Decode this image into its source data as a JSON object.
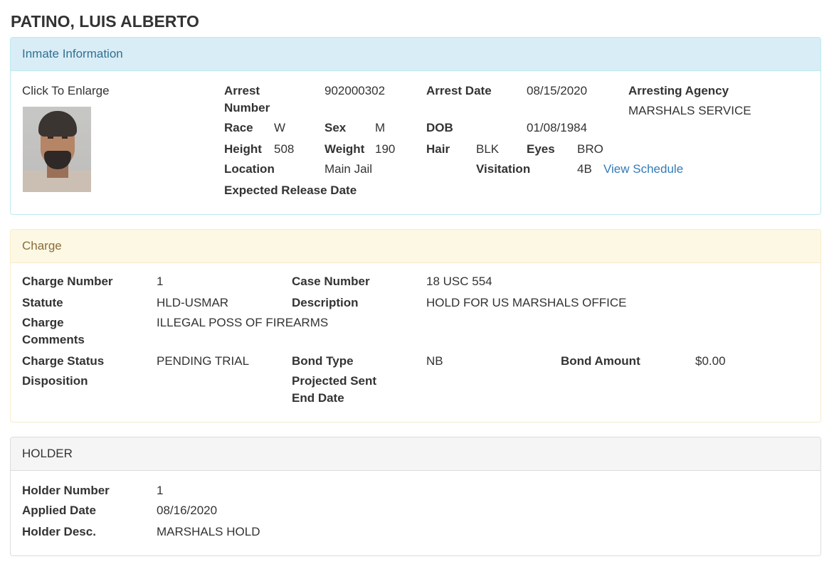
{
  "inmate_name": "PATINO, LUIS ALBERTO",
  "inmate_panel": {
    "heading": "Inmate Information",
    "photo_caption": "Click To Enlarge",
    "arrest_number_label_1": "Arrest",
    "arrest_number_label_2": "Number",
    "arrest_number": "902000302",
    "arrest_date_label": "Arrest Date",
    "arrest_date": "08/15/2020",
    "arresting_agency_label": "Arresting Agency",
    "arresting_agency": "MARSHALS SERVICE",
    "race_label": "Race",
    "race": "W",
    "sex_label": "Sex",
    "sex": "M",
    "dob_label": "DOB",
    "dob": "01/08/1984",
    "height_label": "Height",
    "height": "508",
    "weight_label": "Weight",
    "weight": "190",
    "hair_label": "Hair",
    "hair": "BLK",
    "eyes_label": "Eyes",
    "eyes": "BRO",
    "location_label": "Location",
    "location": "Main Jail",
    "visitation_label": "Visitation",
    "visitation": "4B",
    "view_schedule_link": "View Schedule",
    "expected_release_label": "Expected Release Date"
  },
  "charge_panel": {
    "heading": "Charge",
    "charge_number_label": "Charge Number",
    "charge_number": "1",
    "case_number_label": "Case Number",
    "case_number": "18 USC 554",
    "statute_label": "Statute",
    "statute": "HLD-USMAR",
    "description_label": "Description",
    "description": "HOLD FOR US MARSHALS OFFICE",
    "charge_comments_label_1": "Charge",
    "charge_comments_label_2": "Comments",
    "charge_comments": "ILLEGAL POSS OF FIREARMS",
    "charge_status_label": "Charge Status",
    "charge_status": "PENDING TRIAL",
    "bond_type_label": "Bond Type",
    "bond_type": "NB",
    "bond_amount_label": "Bond Amount",
    "bond_amount": "$0.00",
    "disposition_label": "Disposition",
    "projected_sent_label_1": "Projected Sent",
    "projected_sent_label_2": "End Date"
  },
  "holder_panel": {
    "heading": "HOLDER",
    "holder_number_label": "Holder Number",
    "holder_number": "1",
    "applied_date_label": "Applied Date",
    "applied_date": "08/16/2020",
    "holder_desc_label": "Holder Desc.",
    "holder_desc": "MARSHALS HOLD"
  },
  "colors": {
    "info_heading_bg": "#d9edf7",
    "info_heading_text": "#31708f",
    "warning_heading_bg": "#fcf8e3",
    "warning_heading_text": "#8a6d3b",
    "default_heading_bg": "#f5f5f5",
    "link": "#337ab7"
  }
}
